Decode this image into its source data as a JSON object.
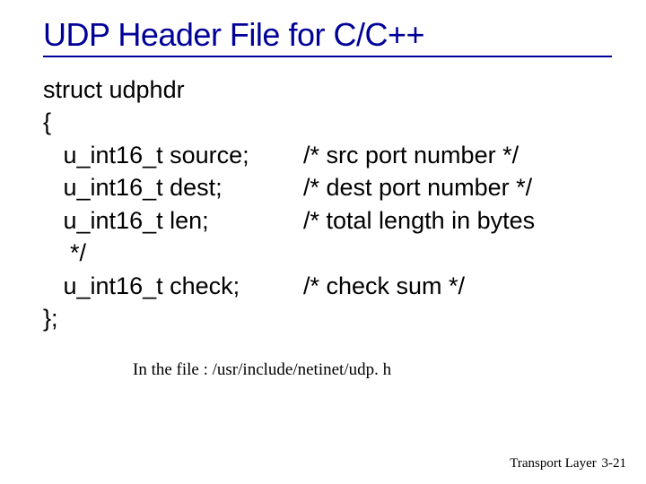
{
  "title": "UDP Header File for C/C++",
  "code": {
    "line1": "struct udphdr",
    "line2": "{",
    "member1_decl": "   u_int16_t source;",
    "member1_comment": "/* src port number */",
    "member2_decl": "   u_int16_t dest;",
    "member2_comment": "/* dest port number */",
    "member3_decl": "   u_int16_t len;",
    "member3_comment": "/* total length in bytes",
    "member3_comment_close": "    */",
    "member4_decl": "   u_int16_t check;",
    "member4_comment": "/* check sum */",
    "line_close": "};"
  },
  "note": "In the file : /usr/include/netinet/udp. h",
  "footer_label": "Transport Layer",
  "footer_page": "3-21"
}
